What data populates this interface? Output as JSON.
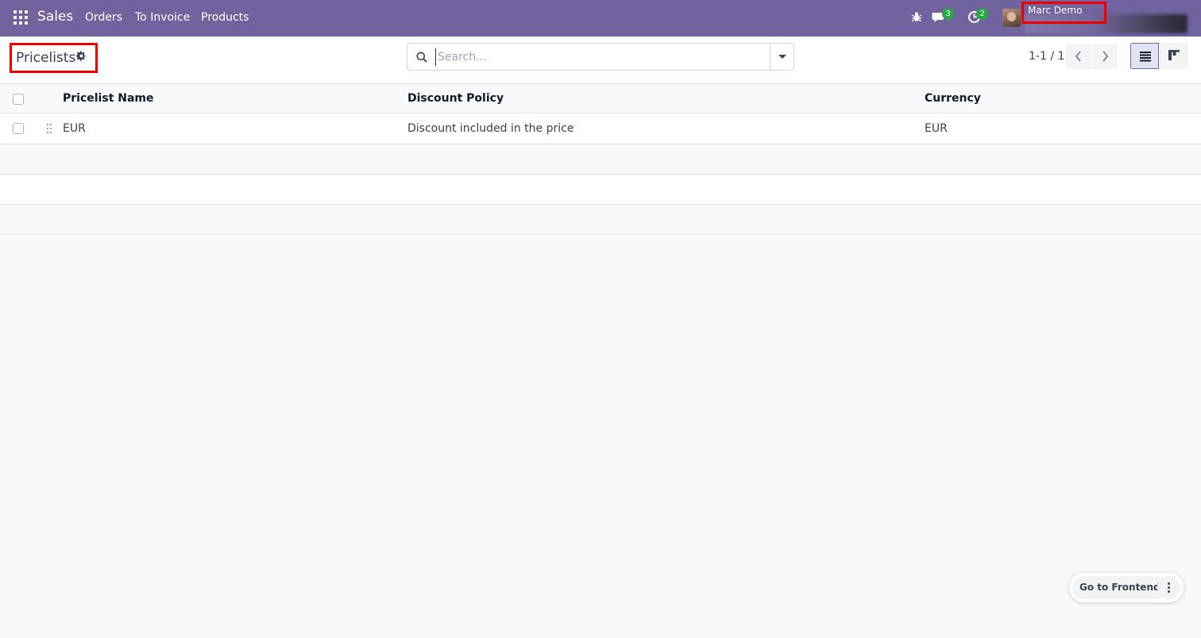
{
  "navbar": {
    "app_name": "Sales",
    "menu": [
      "Orders",
      "To Invoice",
      "Products"
    ],
    "messages_count": "3",
    "activities_count": "2",
    "user_name": "Marc Demo"
  },
  "control_panel": {
    "title": "Pricelists",
    "search_placeholder": "Search...",
    "pager": "1-1 / 1"
  },
  "table": {
    "columns": [
      "Pricelist Name",
      "Discount Policy",
      "Currency"
    ],
    "rows": [
      {
        "name": "EUR",
        "discount_policy": "Discount included in the price",
        "currency": "EUR"
      }
    ]
  },
  "floating": {
    "go_frontend": "Go to Frontend"
  },
  "colors": {
    "navbar": "#71639e",
    "badge": "#28a745",
    "highlight_box": "#ee0000"
  },
  "icons": [
    "apps-grid-icon",
    "bug-icon",
    "chat-icon",
    "clock-icon",
    "gear-icon",
    "search-icon",
    "caret-down-icon",
    "chevron-left-icon",
    "chevron-right-icon",
    "list-view-icon",
    "kanban-view-icon",
    "drag-handle-icon",
    "kebab-icon"
  ]
}
